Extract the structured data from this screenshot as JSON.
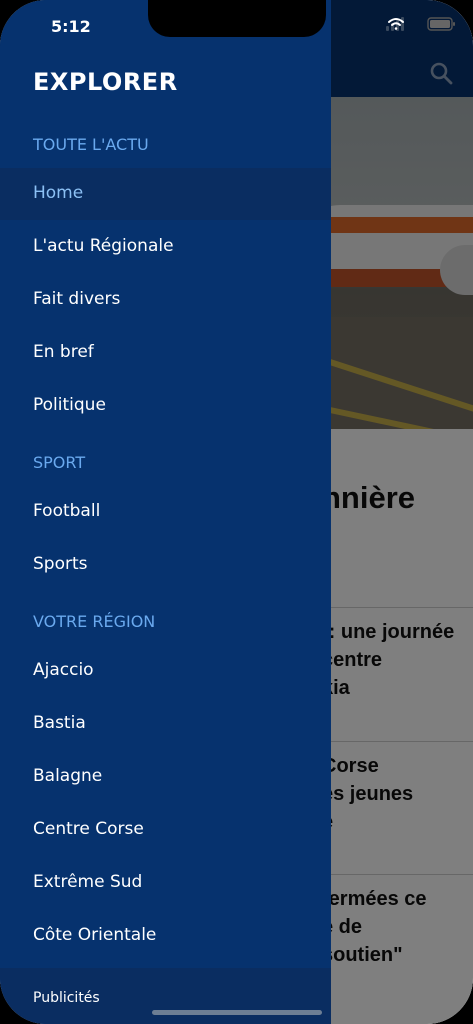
{
  "status_bar": {
    "time": "5:12"
  },
  "drawer": {
    "title": "EXPLORER",
    "sections": [
      {
        "label": "TOUTE L'ACTU",
        "items": [
          "Home",
          "L'actu Régionale",
          "Fait divers",
          "En bref",
          "Politique"
        ]
      },
      {
        "label": "SPORT",
        "items": [
          "Football",
          "Sports"
        ]
      },
      {
        "label": "VOTRE RÉGION",
        "items": [
          "Ajaccio",
          "Bastia",
          "Balagne",
          "Centre Corse",
          "Extrême Sud",
          "Côte Orientale"
        ]
      }
    ],
    "active_item": "Home",
    "footer": "Publicités"
  },
  "background": {
    "headline_fragment": "nnière",
    "stories": [
      [
        "t: une journée",
        "centre",
        "kia"
      ],
      [
        "Corse",
        "es jeunes",
        "e"
      ],
      [
        "fermées ce",
        "e de",
        "soutien\""
      ]
    ]
  },
  "colors": {
    "drawer_bg": "#06326e",
    "active_item_bg": "#0a2d61",
    "section_label": "#6aa9ee",
    "active_label": "#8cc0f4"
  },
  "icons": {
    "search": "search-icon",
    "wifi": "wifi-icon",
    "signal": "signal-icon",
    "battery": "battery-icon"
  }
}
